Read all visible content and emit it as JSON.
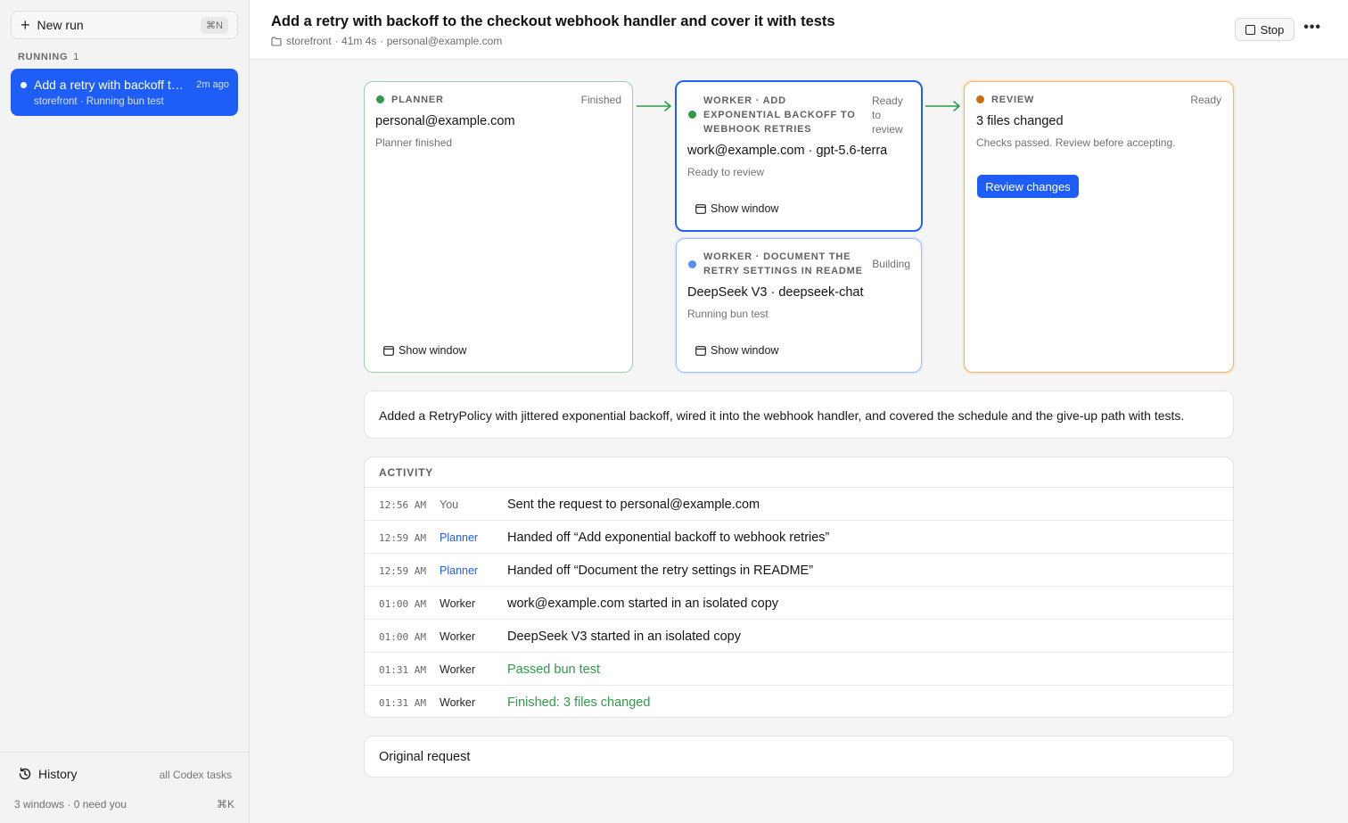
{
  "sidebar": {
    "new_run_label": "New run",
    "new_run_shortcut": "⌘N",
    "section_title": "RUNNING",
    "section_count": "1",
    "run": {
      "title": "Add a retry with backoff to the checkout webhook handler and cover it with tests",
      "ago": "2m ago",
      "subtitle": "storefront · Running bun test"
    },
    "history_label": "History",
    "history_scope": "all Codex tasks",
    "windows_info": "3 windows · 0 need you",
    "shortcut_k": "⌘K"
  },
  "header": {
    "title": "Add a retry with backoff to the checkout webhook handler and cover it with tests",
    "project": "storefront",
    "duration": "· 41m 4s",
    "account": "· personal@example.com",
    "stop_label": "Stop",
    "more_label": "•••"
  },
  "cards": {
    "planner": {
      "title": "PLANNER",
      "status": "Finished",
      "who": "personal@example.com",
      "desc": "Planner finished",
      "show_window": "Show window",
      "dot_color": "#2f9a4a"
    },
    "worker1": {
      "title": "WORKER · ADD EXPONENTIAL BACKOFF TO WEBHOOK RETRIES",
      "status": "Ready to review",
      "who": "work@example.com · gpt-5.6-terra",
      "desc": "Ready to review",
      "show_window": "Show window",
      "dot_color": "#2f9a4a"
    },
    "worker2": {
      "title": "WORKER · DOCUMENT THE RETRY SETTINGS IN README",
      "status": "Building",
      "who": "DeepSeek V3 · deepseek-chat",
      "desc": "Running bun test",
      "show_window": "Show window",
      "dot_color": "#5b8cf4"
    },
    "review": {
      "title": "REVIEW",
      "status": "Ready",
      "who": "3 files changed",
      "desc": "Checks passed. Review before accepting.",
      "button": "Review changes",
      "dot_color": "#c96f0f"
    }
  },
  "summary": "Added a RetryPolicy with jittered exponential backoff, wired it into the webhook handler, and covered the schedule and the give-up path with tests.",
  "activity": {
    "title": "ACTIVITY",
    "rows": [
      {
        "time": "12:56 AM",
        "actor": "You",
        "message": "Sent the request to personal@example.com"
      },
      {
        "time": "12:59 AM",
        "actor": "Planner",
        "message": "Handed off “Add exponential backoff to webhook retries”"
      },
      {
        "time": "12:59 AM",
        "actor": "Planner",
        "message": "Handed off “Document the retry settings in README”"
      },
      {
        "time": "01:00 AM",
        "actor": "Worker",
        "message": "work@example.com started in an isolated copy"
      },
      {
        "time": "01:00 AM",
        "actor": "Worker",
        "message": "DeepSeek V3 started in an isolated copy"
      },
      {
        "time": "01:31 AM",
        "actor": "Worker",
        "message": "Passed bun test"
      },
      {
        "time": "01:31 AM",
        "actor": "Worker",
        "message": "Finished: 3 files changed"
      }
    ]
  },
  "original_request_label": "Original request",
  "colors": {
    "accent": "#1e5ef7",
    "success": "#2f9a4a",
    "warning": "#c96f0f"
  }
}
